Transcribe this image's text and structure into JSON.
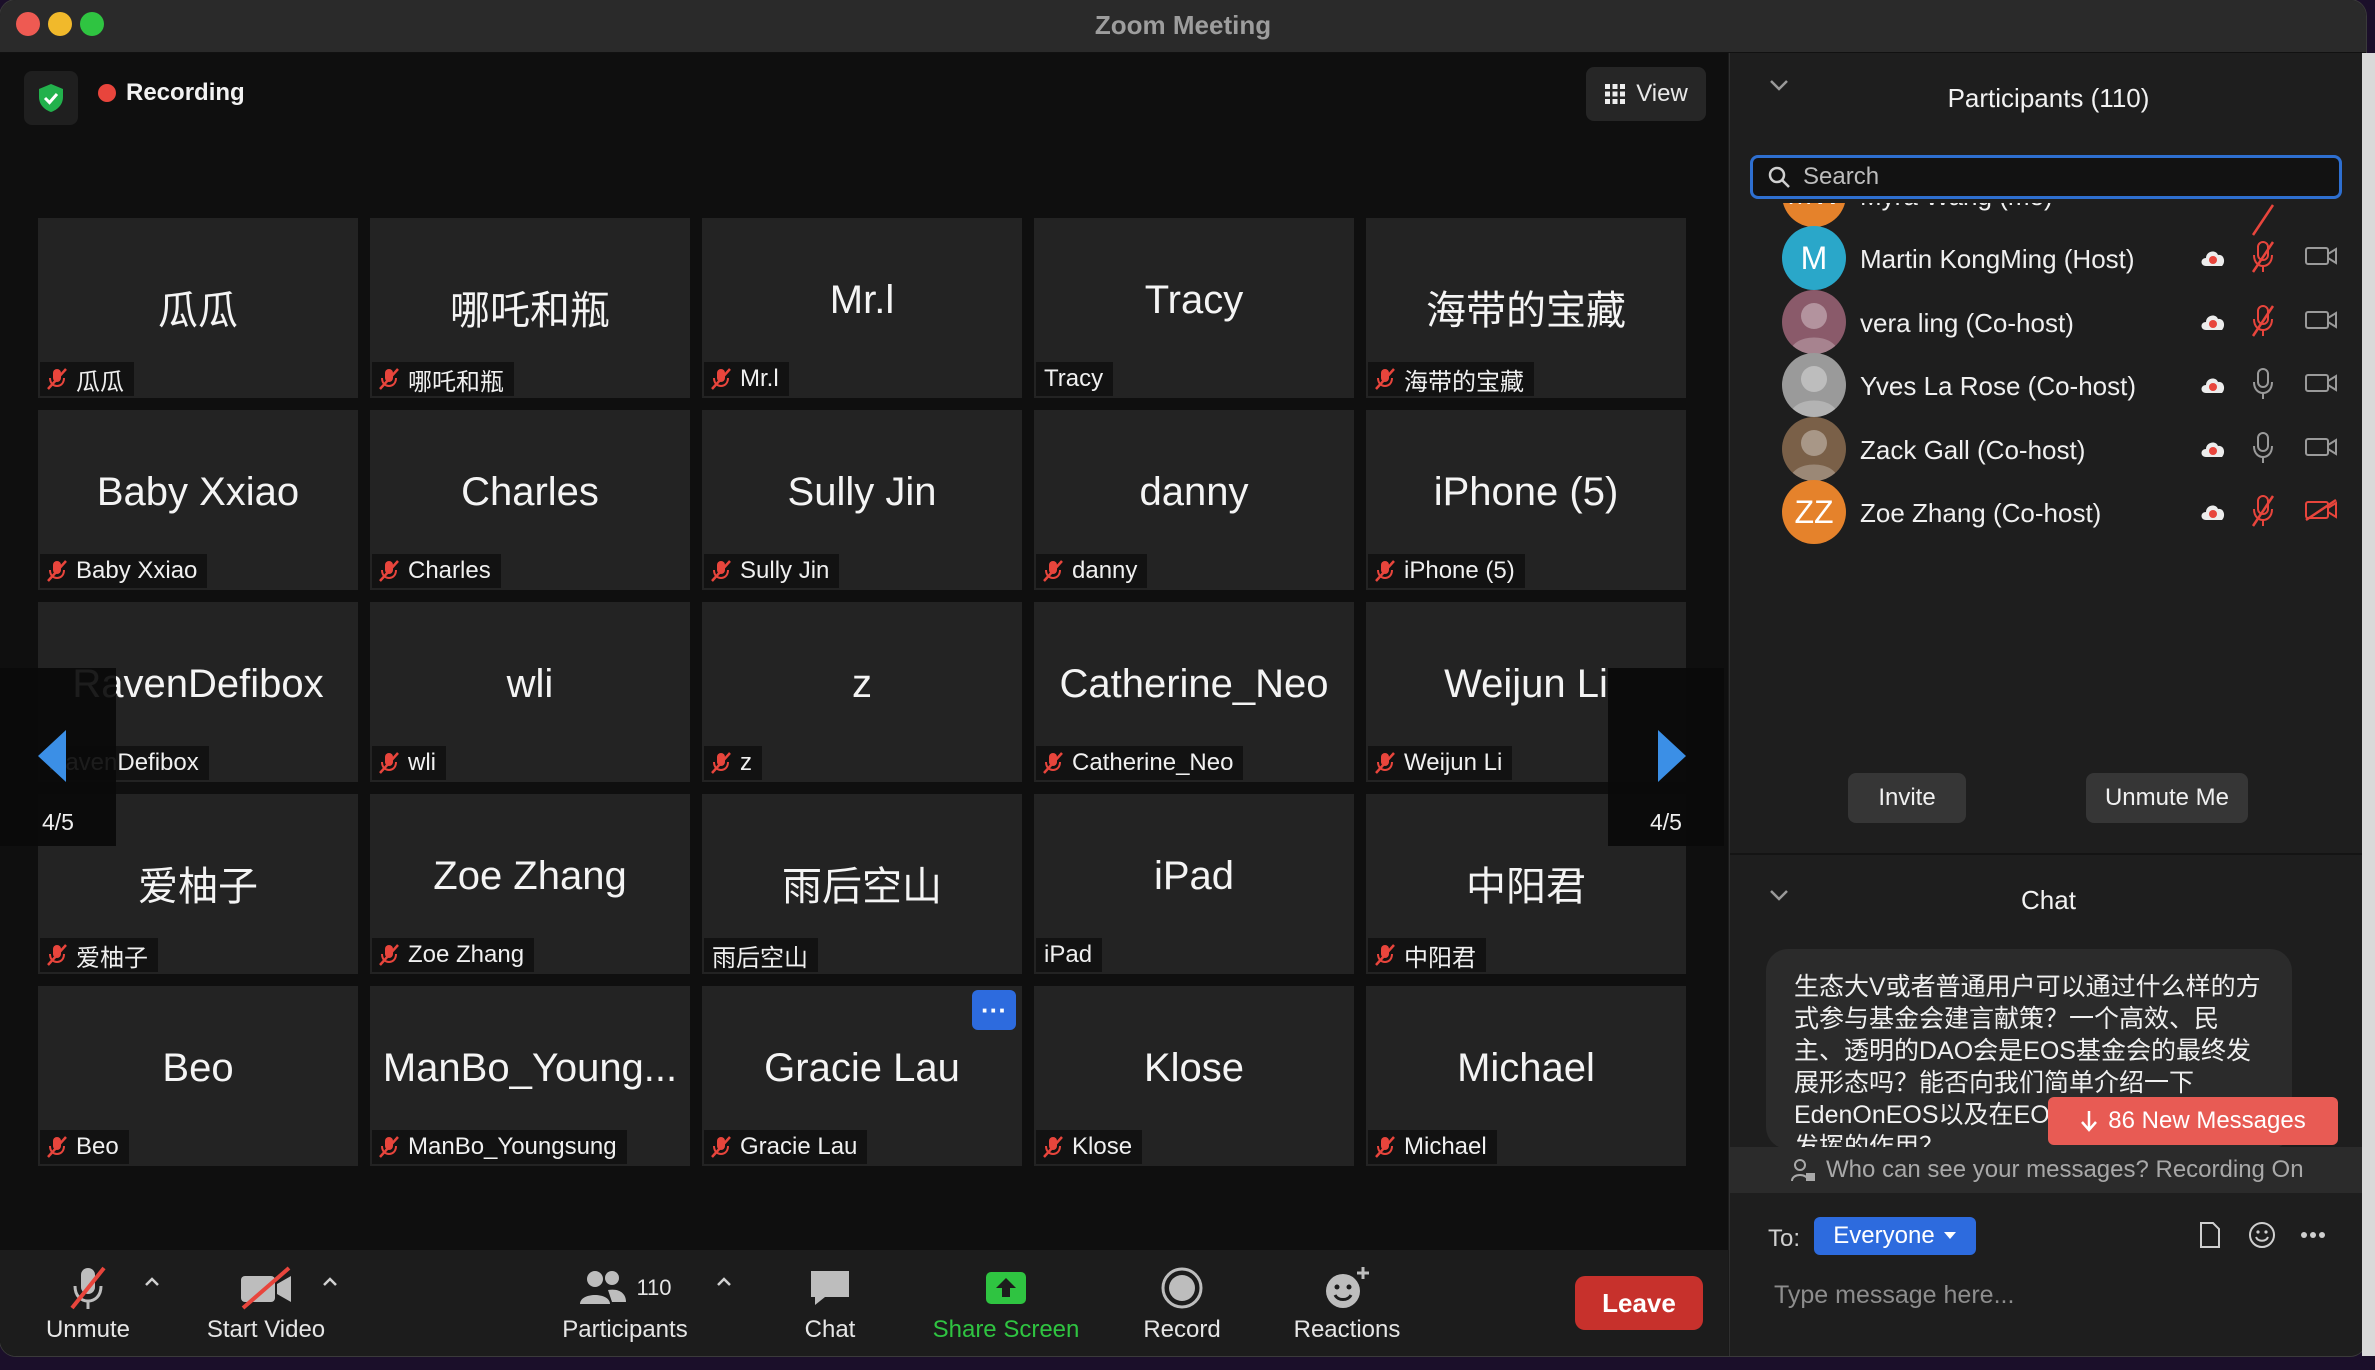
{
  "window": {
    "title": "Zoom Meeting"
  },
  "status": {
    "recording_label": "Recording",
    "view_label": "View"
  },
  "tiles": [
    {
      "big": "瓜瓜",
      "tag": "瓜瓜",
      "muted": true
    },
    {
      "big": "哪吒和瓶",
      "tag": "哪吒和瓶",
      "muted": true
    },
    {
      "big": "Mr.l",
      "tag": "Mr.l",
      "muted": true
    },
    {
      "big": "Tracy",
      "tag": "Tracy",
      "muted": false
    },
    {
      "big": "海带的宝藏",
      "tag": "海带的宝藏",
      "muted": true
    },
    {
      "big": "Baby Xxiao",
      "tag": "Baby Xxiao",
      "muted": true
    },
    {
      "big": "Charles",
      "tag": "Charles",
      "muted": true
    },
    {
      "big": "Sully Jin",
      "tag": "Sully Jin",
      "muted": true
    },
    {
      "big": "danny",
      "tag": "danny",
      "muted": true
    },
    {
      "big": "iPhone (5)",
      "tag": "iPhone (5)",
      "muted": true
    },
    {
      "big": "RavenDefibox",
      "tag": "RavenDefibox",
      "muted": false
    },
    {
      "big": "wli",
      "tag": "wli",
      "muted": true
    },
    {
      "big": "z",
      "tag": "z",
      "muted": true
    },
    {
      "big": "Catherine_Neo",
      "tag": "Catherine_Neo",
      "muted": true
    },
    {
      "big": "Weijun Li",
      "tag": "Weijun Li",
      "muted": true
    },
    {
      "big": "爱柚子",
      "tag": "爱柚子",
      "muted": true
    },
    {
      "big": "Zoe Zhang",
      "tag": "Zoe Zhang",
      "muted": true
    },
    {
      "big": "雨后空山",
      "tag": "雨后空山",
      "muted": false
    },
    {
      "big": "iPad",
      "tag": "iPad",
      "muted": false
    },
    {
      "big": "中阳君",
      "tag": "中阳君",
      "muted": true
    },
    {
      "big": "Beo",
      "tag": "Beo",
      "muted": true
    },
    {
      "big": "ManBo_Young...",
      "tag": "ManBo_Youngsung",
      "muted": true
    },
    {
      "big": "Gracie Lau",
      "tag": "Gracie Lau",
      "muted": true,
      "menu": "···"
    },
    {
      "big": "Klose",
      "tag": "Klose",
      "muted": true
    },
    {
      "big": "Michael",
      "tag": "Michael",
      "muted": true
    }
  ],
  "pager": {
    "left": "4/5",
    "right": "4/5"
  },
  "toolbar": {
    "unmute": "Unmute",
    "start_video": "Start Video",
    "participants": "Participants",
    "participants_count": "110",
    "chat": "Chat",
    "share_screen": "Share Screen",
    "record": "Record",
    "reactions": "Reactions",
    "leave": "Leave"
  },
  "participants_panel": {
    "title": "Participants (110)",
    "search_placeholder": "Search",
    "partial_row": "Myra Wang (me)",
    "rows": [
      {
        "initials": "M",
        "name": "Martin KongMing (Host)",
        "color": "#2aa7c9",
        "mic": "muted",
        "video": "off"
      },
      {
        "initials": "",
        "name": "vera ling (Co-host)",
        "color": "#8a5a6a",
        "mic": "muted",
        "video": "off"
      },
      {
        "initials": "",
        "name": "Yves La Rose (Co-host)",
        "color": "#9a9a9a",
        "mic": "on",
        "video": "off"
      },
      {
        "initials": "",
        "name": "Zack Gall (Co-host)",
        "color": "#7a6048",
        "mic": "on",
        "video": "off"
      },
      {
        "initials": "ZZ",
        "name": "Zoe Zhang (Co-host)",
        "color": "#e5822b",
        "mic": "muted",
        "video": "muted"
      }
    ],
    "invite": "Invite",
    "unmute_me": "Unmute Me"
  },
  "chat_panel": {
    "title": "Chat",
    "message": "生态大V或者普通用户可以通过什么样的方式参与基金会建言献策？一个高效、民主、透明的DAO会是EOS基金会的最终发展形态吗？能否向我们简单介绍一下EdenOnEOS以及在EOS基金会的运作中发挥的作用？",
    "new_messages": "86 New Messages",
    "privacy": "Who can see your messages? Recording On",
    "to_label": "To:",
    "to_value": "Everyone",
    "input_placeholder": "Type message here..."
  }
}
